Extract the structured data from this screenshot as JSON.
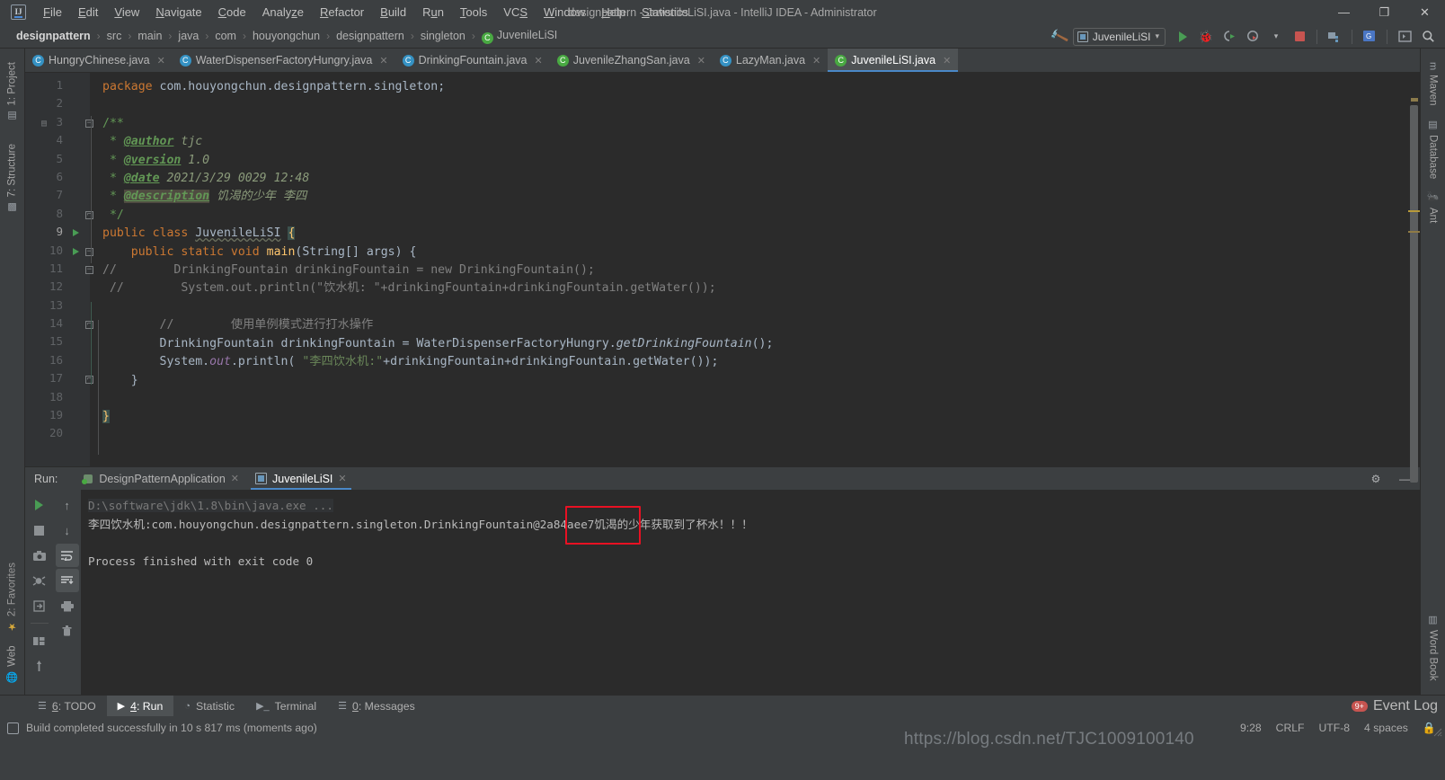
{
  "window": {
    "title": "designpattern - JuvenileLiSI.java - IntelliJ IDEA - Administrator",
    "minimize": "—",
    "maximize": "❐",
    "close": "✕"
  },
  "menubar": {
    "items": [
      "File",
      "Edit",
      "View",
      "Navigate",
      "Code",
      "Analyze",
      "Refactor",
      "Build",
      "Run",
      "Tools",
      "VCS",
      "Window",
      "Help",
      "Statistics"
    ]
  },
  "breadcrumb": {
    "items": [
      "designpattern",
      "src",
      "main",
      "java",
      "com",
      "houyongchun",
      "designpattern",
      "singleton",
      "JuvenileLiSI"
    ],
    "separator": "›",
    "class_icon": "C"
  },
  "toolbar": {
    "build_icon": "build-hammer-icon",
    "run_config": "JuvenileLiSI",
    "dropdown_caret": "▾",
    "run_label": "Run",
    "debug_label": "Debug",
    "run_coverage_label": "Run with Coverage",
    "profile_label": "Profile",
    "stop_label": "Stop",
    "icons": [
      "hammer-icon",
      "run-icon",
      "debug-icon",
      "coverage-icon",
      "profile-icon",
      "stop-icon",
      "project-structure-icon",
      "search-everywhere-icon",
      "update-icon",
      "magnifier-icon"
    ]
  },
  "editor_tabs": [
    {
      "label": "HungryChinese.java",
      "icon": "class",
      "active": false
    },
    {
      "label": "WaterDispenserFactoryHungry.java",
      "icon": "class",
      "active": false
    },
    {
      "label": "DrinkingFountain.java",
      "icon": "class",
      "active": false
    },
    {
      "label": "JuvenileZhangSan.java",
      "icon": "runnable",
      "active": false
    },
    {
      "label": "LazyMan.java",
      "icon": "class",
      "active": false
    },
    {
      "label": "JuvenileLiSI.java",
      "icon": "runnable",
      "active": true
    }
  ],
  "sidebar_left": [
    {
      "label": "1: Project",
      "icon": "project-icon"
    },
    {
      "label": "7: Structure",
      "icon": "structure-icon"
    }
  ],
  "sidebar_right": [
    {
      "label": "Maven",
      "icon": "maven-icon"
    },
    {
      "label": "Database",
      "icon": "database-icon"
    },
    {
      "label": "Ant",
      "icon": "ant-icon"
    },
    {
      "label": "Word Book",
      "icon": "wordbook-icon"
    }
  ],
  "editor": {
    "line_numbers": [
      1,
      2,
      3,
      4,
      5,
      6,
      7,
      8,
      9,
      10,
      11,
      12,
      13,
      14,
      15,
      16,
      17,
      18,
      19,
      20
    ],
    "lines": [
      "package com.houyongchun.designpattern.singleton;",
      "",
      "/**",
      " * @author tjc",
      " * @version 1.0",
      " * @date 2021/3/29 0029 12:48",
      " * @description 饥渴的少年 李四",
      " */",
      "public class JuvenileLiSI {",
      "    public static void main(String[] args) {",
      "//        DrinkingFountain drinkingFountain = new DrinkingFountain();",
      "//        System.out.println(\"饮水机: \"+drinkingFountain+drinkingFountain.getWater());",
      "",
      "        //        使用单例模式进行打水操作",
      "        DrinkingFountain drinkingFountain = WaterDispenserFactoryHungry.getDrinkingFountain();",
      "        System.out.println( \"李四饮水机:\"+drinkingFountain+drinkingFountain.getWater());",
      "    }",
      "",
      "}",
      ""
    ]
  },
  "run_panel": {
    "label": "Run:",
    "tabs": [
      {
        "label": "DesignPatternApplication",
        "icon": "spring-app-icon",
        "active": false,
        "close": "✕"
      },
      {
        "label": "JuvenileLiSI",
        "icon": "class-icon",
        "active": true,
        "close": "✕"
      }
    ],
    "header_buttons": [
      "settings-gear-icon",
      "hide-icon"
    ],
    "tool_buttons_col1": [
      "rerun-icon",
      "stop-icon",
      "camera-icon",
      "thread-dump-icon",
      "export-icon",
      "layout-icon",
      "pin-icon"
    ],
    "tool_buttons_col2": [
      "up-arrow-icon",
      "down-arrow-icon",
      "soft-wrap-icon",
      "scroll-to-end-icon",
      "print-icon",
      "trash-icon"
    ],
    "console": {
      "command_line": "D:\\software\\jdk\\1.8\\bin\\java.exe ...",
      "output_line": "李四饮水机:com.houyongchun.designpattern.singleton.DrinkingFountain@2a84aee7饥渴的少年获取到了杯水！！！",
      "highlight_text": "@2a84aee7",
      "highlight_color": "#e81123",
      "exit_line": "Process finished with exit code 0"
    }
  },
  "toolwindow_tabs": [
    {
      "label": "6: TODO",
      "mnemonic": "6",
      "icon": "todo-icon",
      "active": false
    },
    {
      "label": "4: Run",
      "mnemonic": "4",
      "icon": "run-icon",
      "active": true
    },
    {
      "label": "Statistic",
      "mnemonic": "",
      "icon": "statistic-icon",
      "active": false
    },
    {
      "label": "Terminal",
      "mnemonic": "",
      "icon": "terminal-icon",
      "active": false
    },
    {
      "label": "0: Messages",
      "mnemonic": "0",
      "icon": "messages-icon",
      "active": false
    }
  ],
  "event_log": {
    "label": "Event Log",
    "badge": "9+"
  },
  "statusbar": {
    "message": "Build completed successfully in 10 s 817 ms (moments ago)",
    "caret_position": "9:28",
    "line_separator": "CRLF",
    "encoding": "UTF-8",
    "indent": "4 spaces",
    "lock": "🔒"
  },
  "watermark": {
    "text": "https://blog.csdn.net/TJC1009100140"
  },
  "colors": {
    "accent": "#4a88c7",
    "run_green": "#499c54",
    "stop_red": "#c75450",
    "annotation_red": "#e81123",
    "bg_chrome": "#3c3f41",
    "bg_editor": "#2b2b2b",
    "text": "#a9b7c6"
  }
}
